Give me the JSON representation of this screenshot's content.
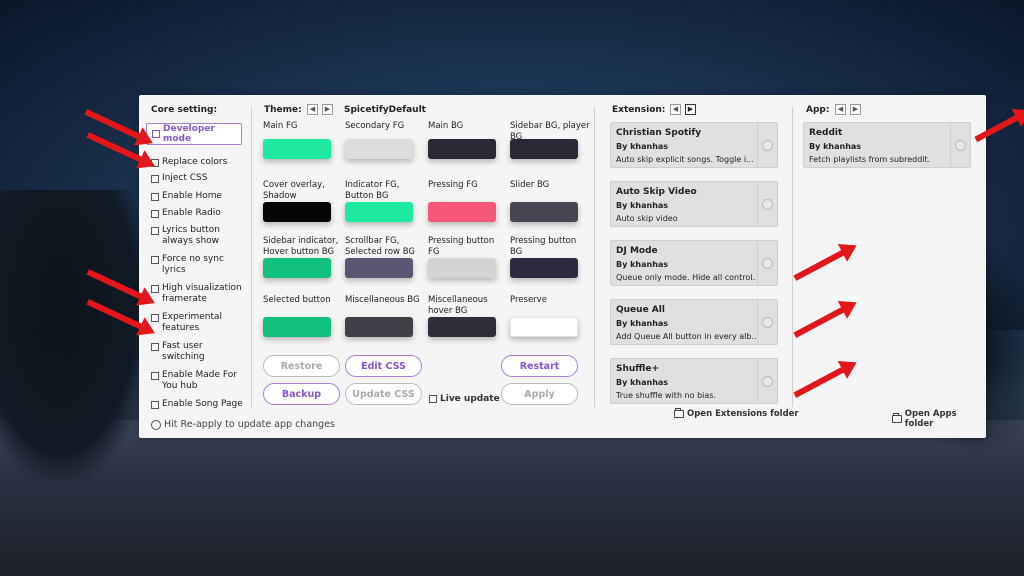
{
  "core": {
    "title": "Core setting:",
    "developer_mode": "Developer mode",
    "items": [
      "Replace colors",
      "Inject CSS",
      "Enable Home",
      "Enable Radio",
      "Lyrics button always show",
      "Force no sync lyrics",
      "High visualization framerate",
      "Experimental features",
      "Fast user switching",
      "Enable Made For You hub",
      "Enable Song Page"
    ],
    "hint": "Hit Re-apply to update app changes"
  },
  "theme": {
    "title": "Theme:",
    "name": "SpicetifyDefault",
    "swatches": [
      {
        "label": "Main FG",
        "color": "#1de9a0"
      },
      {
        "label": "Secondary FG",
        "color": "#dcdcdc"
      },
      {
        "label": "Main BG",
        "color": "#2a2a36"
      },
      {
        "label": "Sidebar BG, player BG",
        "color": "#2a2a36"
      },
      {
        "label": "Cover overlay, Shadow",
        "color": "#050505"
      },
      {
        "label": "Indicator FG, Button BG",
        "color": "#1de9a0"
      },
      {
        "label": "Pressing FG",
        "color": "#f5577a"
      },
      {
        "label": "Slider BG",
        "color": "#464650"
      },
      {
        "label": "Sidebar indicator, Hover button BG",
        "color": "#10c07c"
      },
      {
        "label": "Scrollbar FG, Selected row BG",
        "color": "#5a5570"
      },
      {
        "label": "Pressing button FG",
        "color": "#d4d4d4"
      },
      {
        "label": "Pressing button BG",
        "color": "#2c2a3c"
      },
      {
        "label": "Selected button",
        "color": "#10c07c"
      },
      {
        "label": "Miscellaneous BG",
        "color": "#404048"
      },
      {
        "label": "Miscellaneous hover BG",
        "color": "#2e2e3a"
      },
      {
        "label": "Preserve",
        "color": "#ffffff"
      }
    ],
    "buttons": {
      "restore": "Restore",
      "edit_css": "Edit CSS",
      "restart": "Restart",
      "backup": "Backup",
      "update_css": "Update CSS",
      "live_update": "Live update",
      "apply": "Apply"
    }
  },
  "extensions": {
    "title": "Extension:",
    "items": [
      {
        "name": "Christian Spotify",
        "author": "By khanhas",
        "desc": "Auto skip explicit songs. Toggle i..."
      },
      {
        "name": "Auto Skip Video",
        "author": "By khanhas",
        "desc": "Auto skip video"
      },
      {
        "name": "DJ Mode",
        "author": "By khanhas",
        "desc": "Queue only mode. Hide all control..."
      },
      {
        "name": "Queue All",
        "author": "By khanhas",
        "desc": "Add Queue All button in every alb..."
      },
      {
        "name": "Shuffle+",
        "author": "By khanhas",
        "desc": "True shuffle with no bias."
      }
    ],
    "open_folder": "Open Extensions folder"
  },
  "apps": {
    "title": "App:",
    "items": [
      {
        "name": "Reddit",
        "author": "By khanhas",
        "desc": "Fetch playlists from subreddit."
      }
    ],
    "open_folder": "Open Apps folder"
  },
  "colors": {
    "accent": "#8a55c8",
    "annotation_arrow": "#e3161b"
  }
}
